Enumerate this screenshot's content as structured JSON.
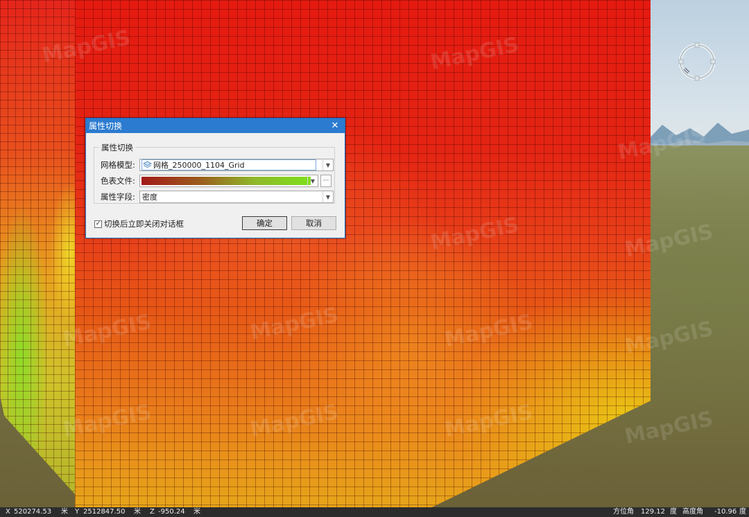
{
  "watermark_text": "MapGIS",
  "dialog": {
    "title": "属性切换",
    "group_label": "属性切换",
    "grid_model": {
      "label": "网格模型:",
      "value": "网格_250000_1104_Grid"
    },
    "color_table": {
      "label": "色表文件:",
      "ellipsis": "···",
      "gradient_colors": [
        "#a31a18",
        "#9b5a1e",
        "#8fb82a",
        "#7fe01b"
      ]
    },
    "attribute_field": {
      "label": "属性字段:",
      "value": "密度"
    },
    "close_after_switch": {
      "label": "切换后立即关闭对话框",
      "checked": true
    },
    "ok_label": "确定",
    "cancel_label": "取消"
  },
  "statusbar": {
    "x": {
      "prefix": "X",
      "value": "520274.53",
      "unit": "米"
    },
    "y": {
      "prefix": "Y",
      "value": "2512847.50",
      "unit": "米"
    },
    "z": {
      "prefix": "Z",
      "value": "-950.24",
      "unit": "米"
    },
    "azimuth": {
      "label": "方位角",
      "value": "129.12",
      "unit": "度"
    },
    "elevation": {
      "label": "高度角",
      "value": "-10.96",
      "unit": "度"
    }
  },
  "colors": {
    "accent": "#2b7bd0",
    "cube_red": "#e51a10",
    "cube_yellow": "#e6e614",
    "ground": "#7f8152"
  }
}
